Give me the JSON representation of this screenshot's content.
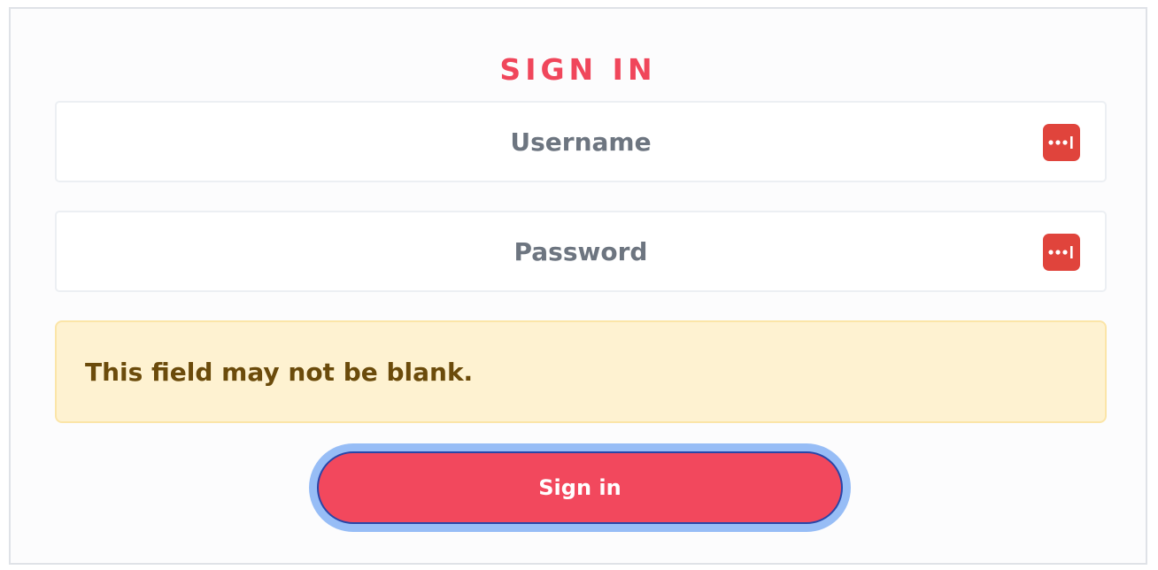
{
  "form": {
    "title": "SIGN IN",
    "username": {
      "placeholder": "Username",
      "value": ""
    },
    "password": {
      "placeholder": "Password",
      "value": ""
    },
    "error_message": "This field may not be blank.",
    "submit_label": "Sign in"
  },
  "icons": {
    "password_manager": "password-manager-icon"
  },
  "colors": {
    "accent": "#f0465b",
    "button_bg": "#f2485d",
    "button_focus_ring": "#97bdf6",
    "button_border": "#2846a8",
    "icon_bg": "#e0443c",
    "alert_bg": "#fef2d1",
    "alert_border": "#fbe5a8",
    "alert_text": "#6b4b0b",
    "input_text": "#6d7580"
  }
}
